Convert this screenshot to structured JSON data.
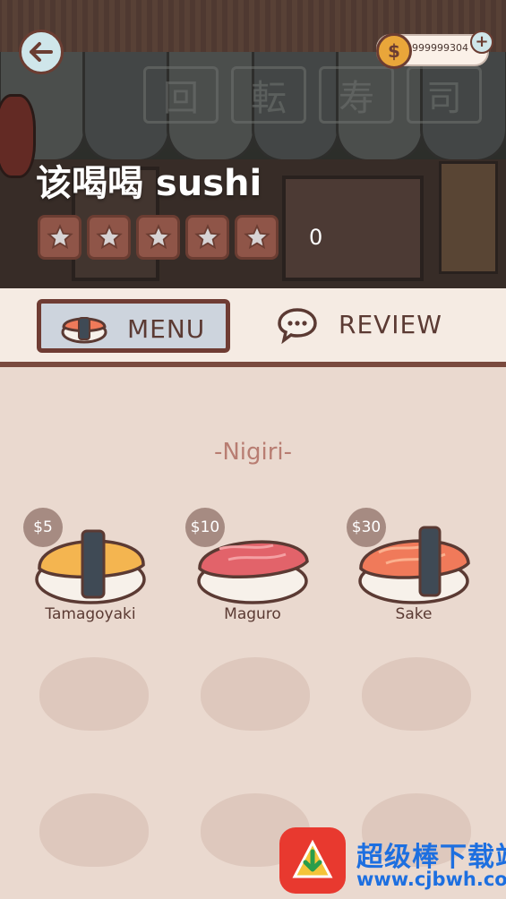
{
  "header": {
    "shop_name": "该喝喝 sushi",
    "rating_count": "0",
    "coins": "999999304",
    "stars_filled": 0,
    "stars_total": 5,
    "sign_chars": [
      "回",
      "転",
      "寿",
      "司"
    ]
  },
  "tabs": [
    {
      "label": "MENU",
      "selected": true
    },
    {
      "label": "REVIEW",
      "selected": false
    }
  ],
  "menu": {
    "category": "-Nigiri-",
    "items": [
      {
        "name": "Tamagoyaki",
        "price": "$5",
        "topping_color": "#f4b550"
      },
      {
        "name": "Maguro",
        "price": "$10",
        "topping_color": "#e2636a"
      },
      {
        "name": "Sake",
        "price": "$30",
        "topping_color": "#f07a5a"
      }
    ],
    "locked_slots": 6
  },
  "watermark": {
    "title": "超级棒下载站",
    "url": "www.cjbwh.com"
  },
  "colors": {
    "accent_brown": "#6f3c33",
    "background": "#ead9cf",
    "watermark_blue": "#1d6fe0"
  }
}
